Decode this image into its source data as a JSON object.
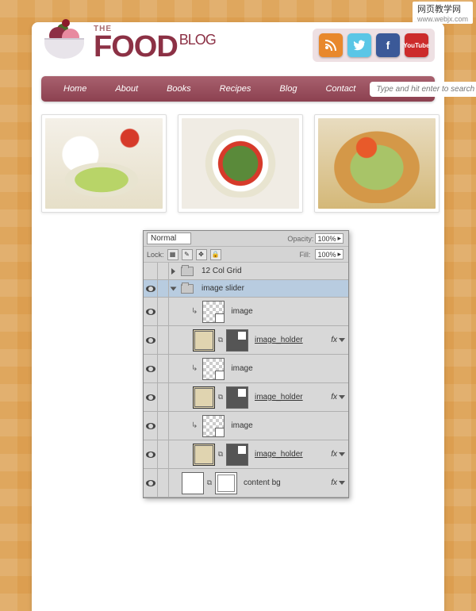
{
  "watermark": {
    "main": "网页教学网",
    "sub": "www.webjx.com"
  },
  "logo": {
    "the": "THE",
    "food": "FOOD",
    "blog": "BLOG"
  },
  "social": {
    "rss": "rss",
    "twitter": "twitter",
    "facebook": "facebook",
    "youtube": "youtube",
    "yt_label": "YouTube"
  },
  "nav": {
    "items": [
      "Home",
      "About",
      "Books",
      "Recipes",
      "Blog",
      "Contact"
    ],
    "search_placeholder": "Type and hit enter to search"
  },
  "panel": {
    "blend_mode": "Normal",
    "opacity_label": "Opacity:",
    "opacity_value": "100%",
    "lock_label": "Lock:",
    "fill_label": "Fill:",
    "fill_value": "100%",
    "fx_label": "fx"
  },
  "layers": [
    {
      "name": "12 Col Grid",
      "type": "group",
      "visible": false,
      "expanded": false
    },
    {
      "name": "image slider",
      "type": "group",
      "visible": true,
      "expanded": true,
      "selected": true
    },
    {
      "name": "image",
      "type": "smart",
      "visible": true,
      "indent": 2
    },
    {
      "name": "image_holder",
      "type": "shape_mask",
      "visible": true,
      "indent": 2,
      "fx": true,
      "link": true
    },
    {
      "name": "image",
      "type": "smart",
      "visible": true,
      "indent": 2
    },
    {
      "name": "image_holder",
      "type": "shape_mask",
      "visible": true,
      "indent": 2,
      "fx": true,
      "link": true
    },
    {
      "name": "image",
      "type": "smart",
      "visible": true,
      "indent": 2
    },
    {
      "name": "image_holder",
      "type": "shape_mask",
      "visible": true,
      "indent": 2,
      "fx": true,
      "link": true
    },
    {
      "name": "content bg",
      "type": "content_bg",
      "visible": true,
      "indent": 1,
      "fx": true
    }
  ]
}
